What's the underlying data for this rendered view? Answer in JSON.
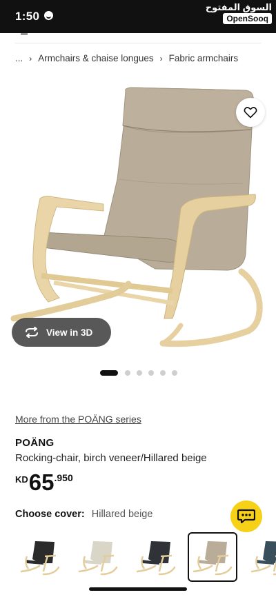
{
  "status_bar": {
    "time": "1:50"
  },
  "watermark": {
    "arabic": "السوق المفتوح",
    "english": "OpenSooq"
  },
  "breadcrumb": {
    "ellipsis": "...",
    "items": [
      "Armchairs & chaise longues",
      "Fabric armchairs"
    ]
  },
  "gallery": {
    "view_3d_label": "View in 3D",
    "dot_count": 6,
    "active_index": 0
  },
  "product": {
    "series_link": "More from the POÄNG series",
    "name": "POÄNG",
    "description": "Rocking-chair, birch veneer/Hillared beige",
    "price_currency": "KD",
    "price_integer": "65",
    "price_decimal": ".950"
  },
  "cover": {
    "label": "Choose cover:",
    "selected": "Hillared beige",
    "swatches": [
      {
        "color": "#2b2b2b",
        "selected": false
      },
      {
        "color": "#d9d5c7",
        "selected": false
      },
      {
        "color": "#2f3338",
        "selected": false
      },
      {
        "color": "#b9ac98",
        "selected": true
      },
      {
        "color": "#3a4f5c",
        "selected": false
      }
    ]
  },
  "colors": {
    "accent_yellow": "#f7d117",
    "fabric": "#b9ac98",
    "wood": "#e9d5a8"
  }
}
